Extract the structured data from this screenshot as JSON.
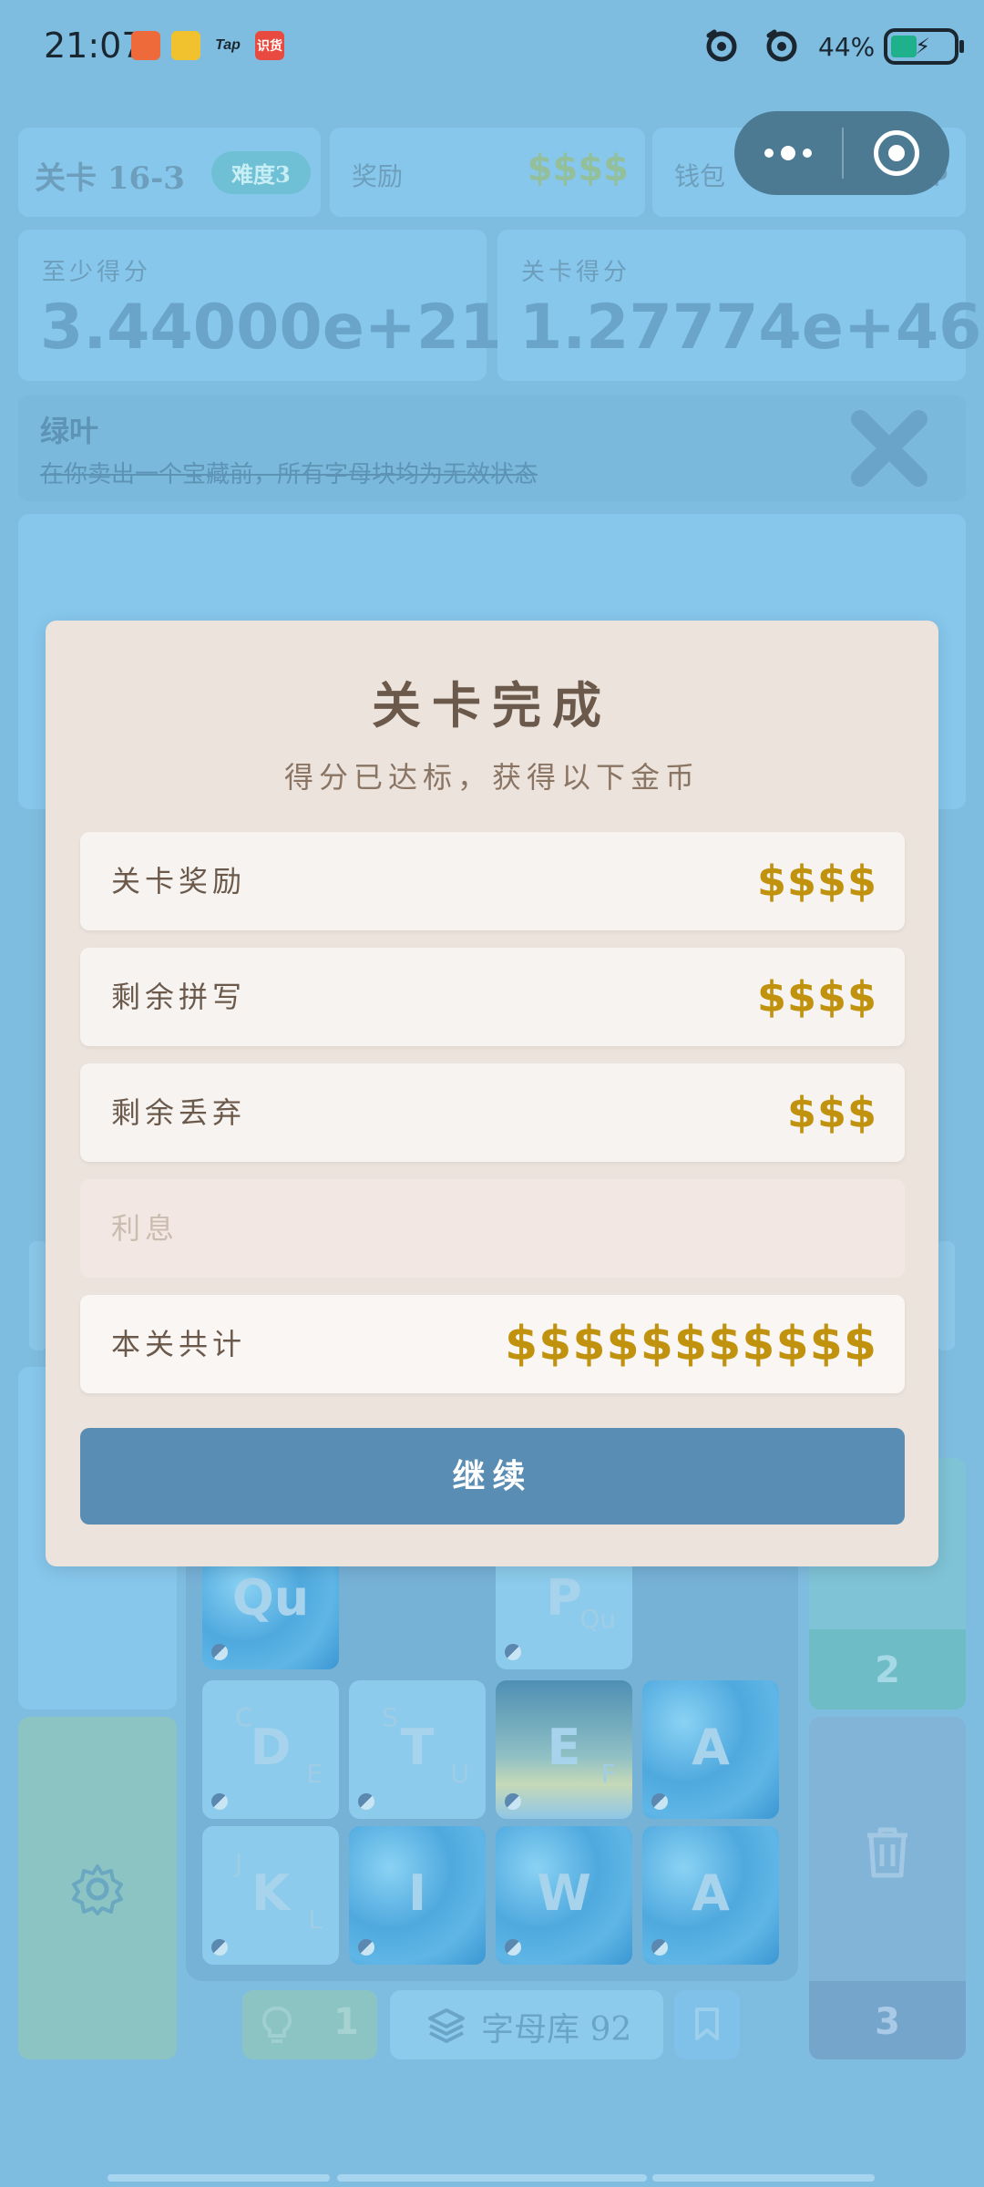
{
  "status_bar": {
    "time": "21:07",
    "battery": "44%",
    "app_icons": [
      {
        "name": "app-icon-1",
        "text": "",
        "color": "#ee6a3a"
      },
      {
        "name": "weibo-icon",
        "text": "",
        "color": "#f2c22e"
      },
      {
        "name": "taptap-icon",
        "text": "Tap",
        "color": "transparent"
      },
      {
        "name": "app-icon-4",
        "text": "识货",
        "color": "#e84a3f"
      }
    ]
  },
  "game": {
    "level_label": "关卡 16-3",
    "difficulty": "难度3",
    "reward_label": "奖励",
    "reward_value": "$$$$",
    "wallet_label": "钱包",
    "wallet_value": "$$$$",
    "min_score_label": "至少得分",
    "min_score_value": "3.44000e+21",
    "level_score_label": "关卡得分",
    "level_score_value": "1.27774e+46",
    "effect_title": "绿叶",
    "effect_desc": "在你卖出一个宝藏前，所有字母块均为无效状态",
    "right_count_top": "2",
    "right_count_bottom": "3",
    "hint_count": "1",
    "library_label": "字母库 92"
  },
  "tiles": [
    {
      "letter": "Qu",
      "sub_tl": "",
      "sub_br": "",
      "style": "water"
    },
    {
      "letter": "P",
      "sub_tl": "O",
      "sub_br": "Qu",
      "style": "plain"
    },
    {
      "letter": "D",
      "sub_tl": "C",
      "sub_br": "E",
      "style": "plain"
    },
    {
      "letter": "T",
      "sub_tl": "S",
      "sub_br": "U",
      "style": "plain"
    },
    {
      "letter": "E",
      "sub_tl": "",
      "sub_br": "F",
      "style": "glow"
    },
    {
      "letter": "A",
      "sub_tl": "",
      "sub_br": "",
      "style": "water"
    },
    {
      "letter": "K",
      "sub_tl": "J",
      "sub_br": "L",
      "style": "plain"
    },
    {
      "letter": "I",
      "sub_tl": "",
      "sub_br": "",
      "style": "water"
    },
    {
      "letter": "W",
      "sub_tl": "",
      "sub_br": "",
      "style": "water"
    },
    {
      "letter": "A",
      "sub_tl": "",
      "sub_br": "",
      "style": "water"
    }
  ],
  "modal": {
    "title": "关卡完成",
    "subtitle": "得分已达标，获得以下金币",
    "rows": [
      {
        "label": "关卡奖励",
        "value": "$$$$"
      },
      {
        "label": "剩余拼写",
        "value": "$$$$"
      },
      {
        "label": "剩余丢弃",
        "value": "$$$"
      },
      {
        "label": "利息",
        "value": ""
      },
      {
        "label": "本关共计",
        "value": "$$$$$$$$$$$"
      }
    ],
    "continue_label": "继续"
  },
  "colors": {
    "background": "#7fbde0",
    "modal": "#ece3dc",
    "coin": "#c0920e",
    "button": "#5a8db4"
  }
}
